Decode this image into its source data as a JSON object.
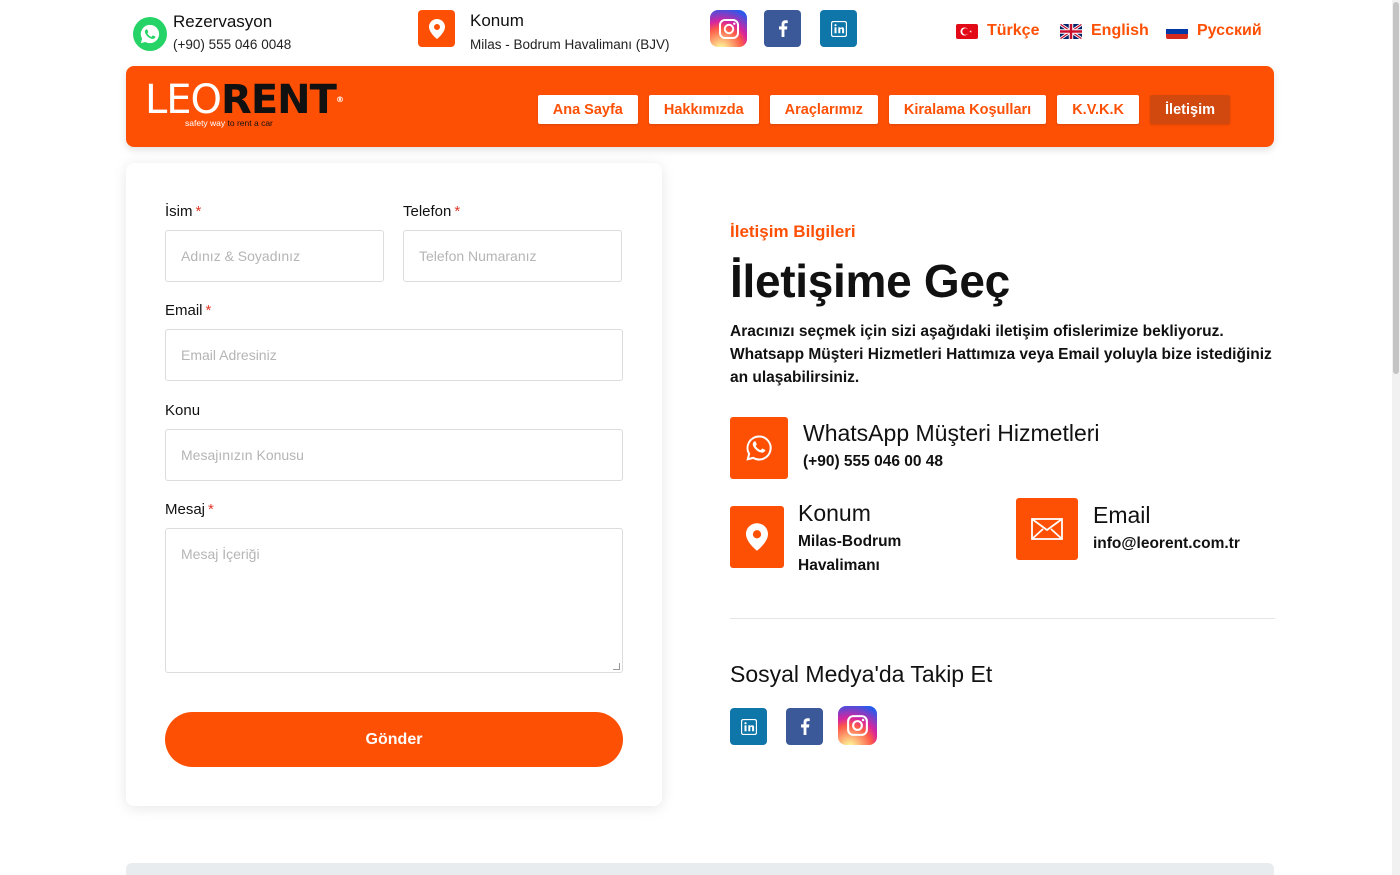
{
  "topbar": {
    "reservation": {
      "title": "Rezervasyon",
      "phone": "(+90) 555 046 0048",
      "icon": "whatsapp-icon"
    },
    "location": {
      "title": "Konum",
      "address": "Milas - Bodrum Havalimanı (BJV)",
      "icon": "map-pin-icon"
    },
    "socials": [
      "instagram-icon",
      "facebook-icon",
      "linkedin-icon"
    ],
    "languages": [
      {
        "label": "Türkçe",
        "flag": "turkey-flag-icon"
      },
      {
        "label": "English",
        "flag": "uk-flag-icon"
      },
      {
        "label": "Русский",
        "flag": "russia-flag-icon"
      }
    ]
  },
  "brand": {
    "name_part1": "LEO",
    "name_part2": "RENT",
    "tag_part1": "safety way",
    "tag_part2": "to rent a car",
    "color": "#fe5005"
  },
  "nav": {
    "items": [
      {
        "label": "Ana Sayfa"
      },
      {
        "label": "Hakkımızda"
      },
      {
        "label": "Araçlarımız"
      },
      {
        "label": "Kiralama Koşulları"
      },
      {
        "label": "K.V.K.K"
      },
      {
        "label": "İletişim",
        "active": true
      }
    ]
  },
  "form": {
    "name": {
      "label": "İsim",
      "required": "*",
      "placeholder": "Adınız & Soyadınız"
    },
    "phone": {
      "label": "Telefon",
      "required": "*",
      "placeholder": "Telefon Numaranız"
    },
    "email": {
      "label": "Email",
      "required": "*",
      "placeholder": "Email Adresiniz"
    },
    "subject": {
      "label": "Konu",
      "placeholder": "Mesajınızın Konusu"
    },
    "message": {
      "label": "Mesaj",
      "required": "*",
      "placeholder": "Mesaj İçeriği"
    },
    "submit_label": "Gönder"
  },
  "contact": {
    "eyebrow": "İletişim Bilgileri",
    "heading": "İletişime Geç",
    "description": "Aracınızı seçmek için sizi aşağıdaki iletişim ofislerimize bekliyoruz. Whatsapp Müşteri Hizmetleri Hattımıza veya Email yoluyla bize istediğiniz an ulaşabilirsiniz.",
    "whatsapp": {
      "title": "WhatsApp Müşteri Hizmetleri",
      "value": "(+90) 555 046 00 48"
    },
    "location": {
      "title": "Konum",
      "value_line1": "Milas-Bodrum",
      "value_line2": "Havalimanı"
    },
    "email": {
      "title": "Email",
      "value": "info@leorent.com.tr"
    },
    "social_title": "Sosyal Medya'da Takip Et",
    "socials": [
      "linkedin-icon",
      "facebook-icon",
      "instagram-icon"
    ]
  }
}
